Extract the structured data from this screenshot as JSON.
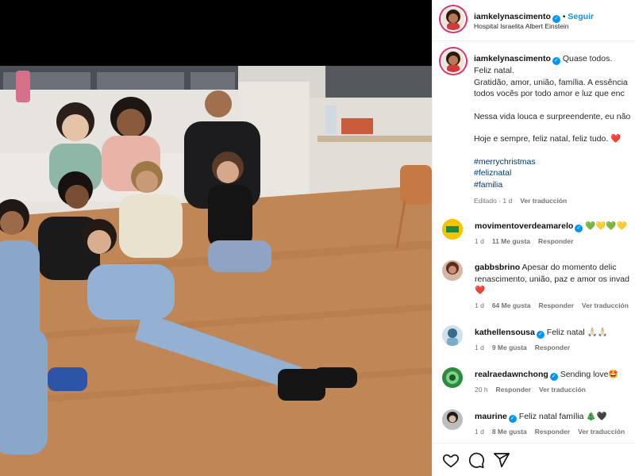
{
  "post": {
    "author": "iamkelynascimento",
    "follow_label": "Seguir",
    "location": "Hospital Israelita Albert Einstein",
    "caption": {
      "lines": [
        "Quase todos.",
        "Feliz natal.",
        "Gratidão, amor, união, família. A essência",
        "todos vocês por todo amor e luz que enc",
        "",
        "Nessa vida louca e surpreendente, eu não",
        "",
        "Hoje e sempre, feliz natal, feliz tudo. ❤️",
        ""
      ],
      "hashtags": [
        "#merrychristmas",
        "#feliznatal",
        "#familia"
      ],
      "meta_time": "Editado · 1 d",
      "meta_translate": "Ver traducción"
    }
  },
  "comments": [
    {
      "user": "movimentoverdeamarelo",
      "text": "💚💛💚💛",
      "time": "1 d",
      "likes": "11 Me gusta",
      "reply": "Responder",
      "translate": "",
      "avatar_color": "#f4c400"
    },
    {
      "user": "gabbsbrino",
      "text": "Apesar do momento delic",
      "text2": "renascimento, união, paz e amor os invad",
      "text3": "❤️",
      "time": "1 d",
      "likes": "64 Me gusta",
      "reply": "Responder",
      "translate": "Ver traducción",
      "avatar_color": "#8a4a3a"
    },
    {
      "user": "kathellensousa",
      "text": "Feliz natal 🙏🏻🙏🏻",
      "time": "1 d",
      "likes": "9 Me gusta",
      "reply": "Responder",
      "translate": "",
      "avatar_color": "#6aa0c8"
    },
    {
      "user": "realraedawnchong",
      "text": "Sending love🤩",
      "time": "20 h",
      "likes": "",
      "reply": "Responder",
      "translate": "Ver traducción",
      "avatar_color": "#3aa84a"
    },
    {
      "user": "maurine",
      "text": "Feliz natal família 🎄🖤",
      "time": "1 d",
      "likes": "8 Me gusta",
      "reply": "Responder",
      "translate": "Ver traducción",
      "avatar_color": "#444"
    }
  ],
  "icons": {
    "like": "heart-icon",
    "comment": "comment-icon",
    "share": "share-icon",
    "verified": "verified-badge-icon"
  },
  "colors": {
    "link": "#0095f6",
    "hashtag": "#00376b",
    "muted": "#737373",
    "verified": "#0095f6"
  }
}
